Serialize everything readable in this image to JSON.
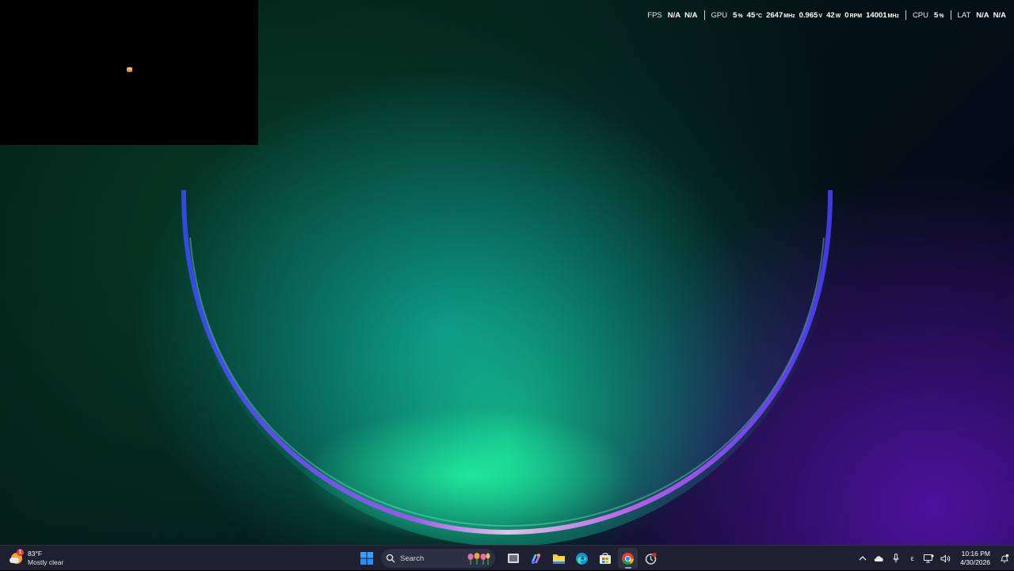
{
  "perf_overlay": {
    "fps": {
      "label": "FPS",
      "v1": "N/A",
      "v2": "N/A"
    },
    "gpu": {
      "label": "GPU",
      "usage": "5",
      "usage_unit": "%",
      "temp": "45",
      "temp_unit": "°C",
      "clock": "2647",
      "clock_unit": "MHz",
      "voltage": "0.965",
      "voltage_unit": "V",
      "power": "42",
      "power_unit": "W",
      "fan": "0",
      "fan_unit": "RPM",
      "mem_clock": "14001",
      "mem_clock_unit": "MHz"
    },
    "cpu": {
      "label": "CPU",
      "usage": "5",
      "usage_unit": "%"
    },
    "lat": {
      "label": "LAT",
      "v1": "N/A",
      "v2": "N/A"
    }
  },
  "taskbar": {
    "weather": {
      "temp": "83°F",
      "description": "Mostly clear",
      "badge": "1",
      "icon": "partly-cloudy-night-icon"
    },
    "search": {
      "label": "Search"
    },
    "apps": [
      {
        "name": "start-button",
        "icon": "windows-logo-icon"
      },
      {
        "name": "task-view-button",
        "icon": "task-view-icon"
      },
      {
        "name": "copilot-button",
        "icon": "copilot-icon"
      },
      {
        "name": "file-explorer-button",
        "icon": "folder-icon"
      },
      {
        "name": "edge-button",
        "icon": "edge-icon"
      },
      {
        "name": "store-button",
        "icon": "store-icon"
      },
      {
        "name": "chrome-button",
        "icon": "chrome-icon"
      },
      {
        "name": "app-button",
        "icon": "app-icon"
      }
    ],
    "tray": {
      "chevron": "^",
      "input_indicator": "ε"
    },
    "clock": {
      "time": "10:16 PM",
      "date": "4/30/2026"
    }
  },
  "colors": {
    "taskbar_bg": "#1c2030",
    "accent_blue": "#2f8fe8"
  }
}
